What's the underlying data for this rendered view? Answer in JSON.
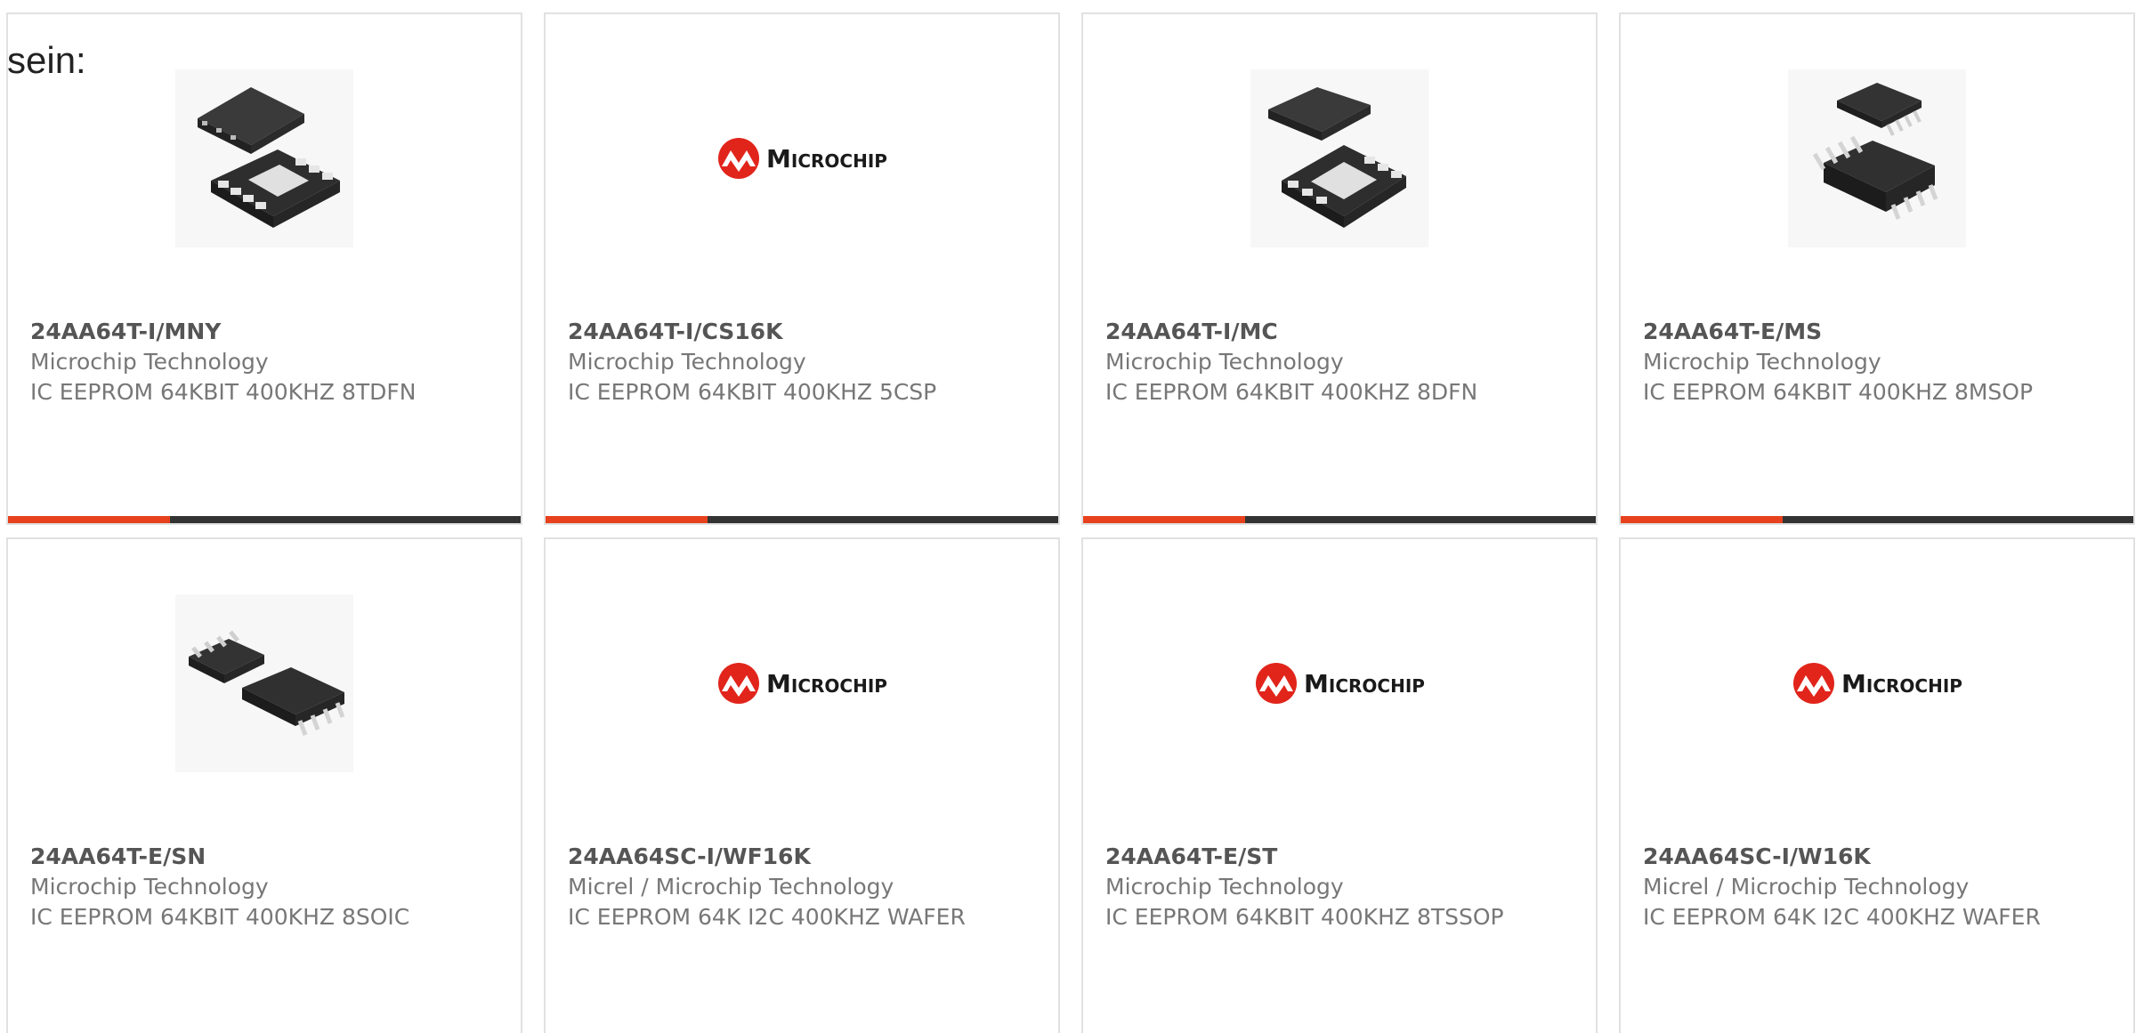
{
  "intro_text": "sein:",
  "colors": {
    "accent": "#e8411d",
    "bar_dark": "#333333",
    "logo_red": "#e1251b"
  },
  "products": [
    {
      "part": "24AA64T-I/MNY",
      "manufacturer": "Microchip Technology",
      "description": "IC EEPROM 64KBIT 400KHZ 8TDFN",
      "image": "tdfn-chip-photo"
    },
    {
      "part": "24AA64T-I/CS16K",
      "manufacturer": "Microchip Technology",
      "description": "IC EEPROM 64KBIT 400KHZ 5CSP",
      "image": "microchip-logo",
      "logo_text": "Microchip"
    },
    {
      "part": "24AA64T-I/MC",
      "manufacturer": "Microchip Technology",
      "description": "IC EEPROM 64KBIT 400KHZ 8DFN",
      "image": "dfn-chip-photo"
    },
    {
      "part": "24AA64T-E/MS",
      "manufacturer": "Microchip Technology",
      "description": "IC EEPROM 64KBIT 400KHZ 8MSOP",
      "image": "msop-chip-photo"
    },
    {
      "part": "24AA64T-E/SN",
      "manufacturer": "Microchip Technology",
      "description": "IC EEPROM 64KBIT 400KHZ 8SOIC",
      "image": "soic-chip-photo"
    },
    {
      "part": "24AA64SC-I/WF16K",
      "manufacturer": "Micrel / Microchip Technology",
      "description": "IC EEPROM 64K I2C 400KHZ WAFER",
      "image": "microchip-logo",
      "logo_text": "Microchip"
    },
    {
      "part": "24AA64T-E/ST",
      "manufacturer": "Microchip Technology",
      "description": "IC EEPROM 64KBIT 400KHZ 8TSSOP",
      "image": "microchip-logo",
      "logo_text": "Microchip"
    },
    {
      "part": "24AA64SC-I/W16K",
      "manufacturer": "Micrel / Microchip Technology",
      "description": "IC EEPROM 64K I2C 400KHZ WAFER",
      "image": "microchip-logo",
      "logo_text": "Microchip"
    }
  ]
}
